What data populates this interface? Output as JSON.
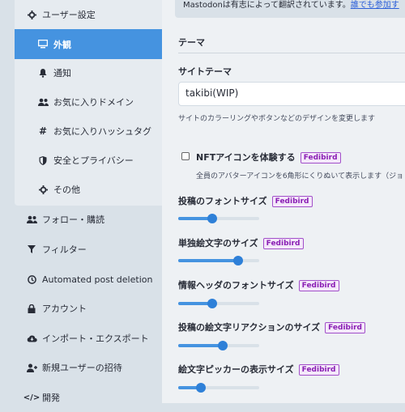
{
  "sidebar": {
    "items": [
      {
        "label": "ユーザー設定",
        "icon": "gear-icon"
      },
      {
        "label": "外観",
        "icon": "desktop-icon",
        "active": true
      },
      {
        "label": "通知",
        "icon": "bell-icon"
      },
      {
        "label": "お気に入りドメイン",
        "icon": "users-icon"
      },
      {
        "label": "お気に入りハッシュタグ",
        "icon": "hashtag-icon"
      },
      {
        "label": "安全とプライバシー",
        "icon": "shield-icon"
      },
      {
        "label": "その他",
        "icon": "gear-icon"
      },
      {
        "label": "フォロー・購読",
        "icon": "users-icon"
      },
      {
        "label": "フィルター",
        "icon": "filter-icon"
      },
      {
        "label": "Automated post deletion",
        "icon": "history-icon"
      },
      {
        "label": "アカウント",
        "icon": "lock-icon"
      },
      {
        "label": "インポート・エクスポート",
        "icon": "cloud-download-icon"
      },
      {
        "label": "新規ユーザーの招待",
        "icon": "user-plus-icon"
      },
      {
        "label": "開発",
        "icon": "code-icon"
      }
    ]
  },
  "notice": {
    "text": "Mastodonは有志によって翻訳されています。",
    "link": "誰でも参加す"
  },
  "main": {
    "section_title": "テーマ",
    "site_theme_label": "サイトテーマ",
    "site_theme_value": "takibi(WIP)",
    "site_theme_hint": "サイトのカラーリングやボタンなどのデザインを変更します",
    "nft_label": "NFTアイコンを体験する",
    "nft_hint": "全員のアバターアイコンを6角形にくりぬいて表示します（ジョ",
    "badge": "Fedibird",
    "sliders": [
      {
        "label": "投稿のフォントサイズ",
        "value": 0.42
      },
      {
        "label": "単独絵文字のサイズ",
        "value": 0.74
      },
      {
        "label": "情報ヘッダのフォントサイズ",
        "value": 0.42
      },
      {
        "label": "投稿の絵文字リアクションのサイズ",
        "value": 0.55
      },
      {
        "label": "絵文字ピッカーの表示サイズ",
        "value": 0.28
      }
    ]
  },
  "colors": {
    "accent": "#4593e0",
    "sidebar_bg": "#d9e1e8",
    "badge": "#8a1eb4"
  }
}
